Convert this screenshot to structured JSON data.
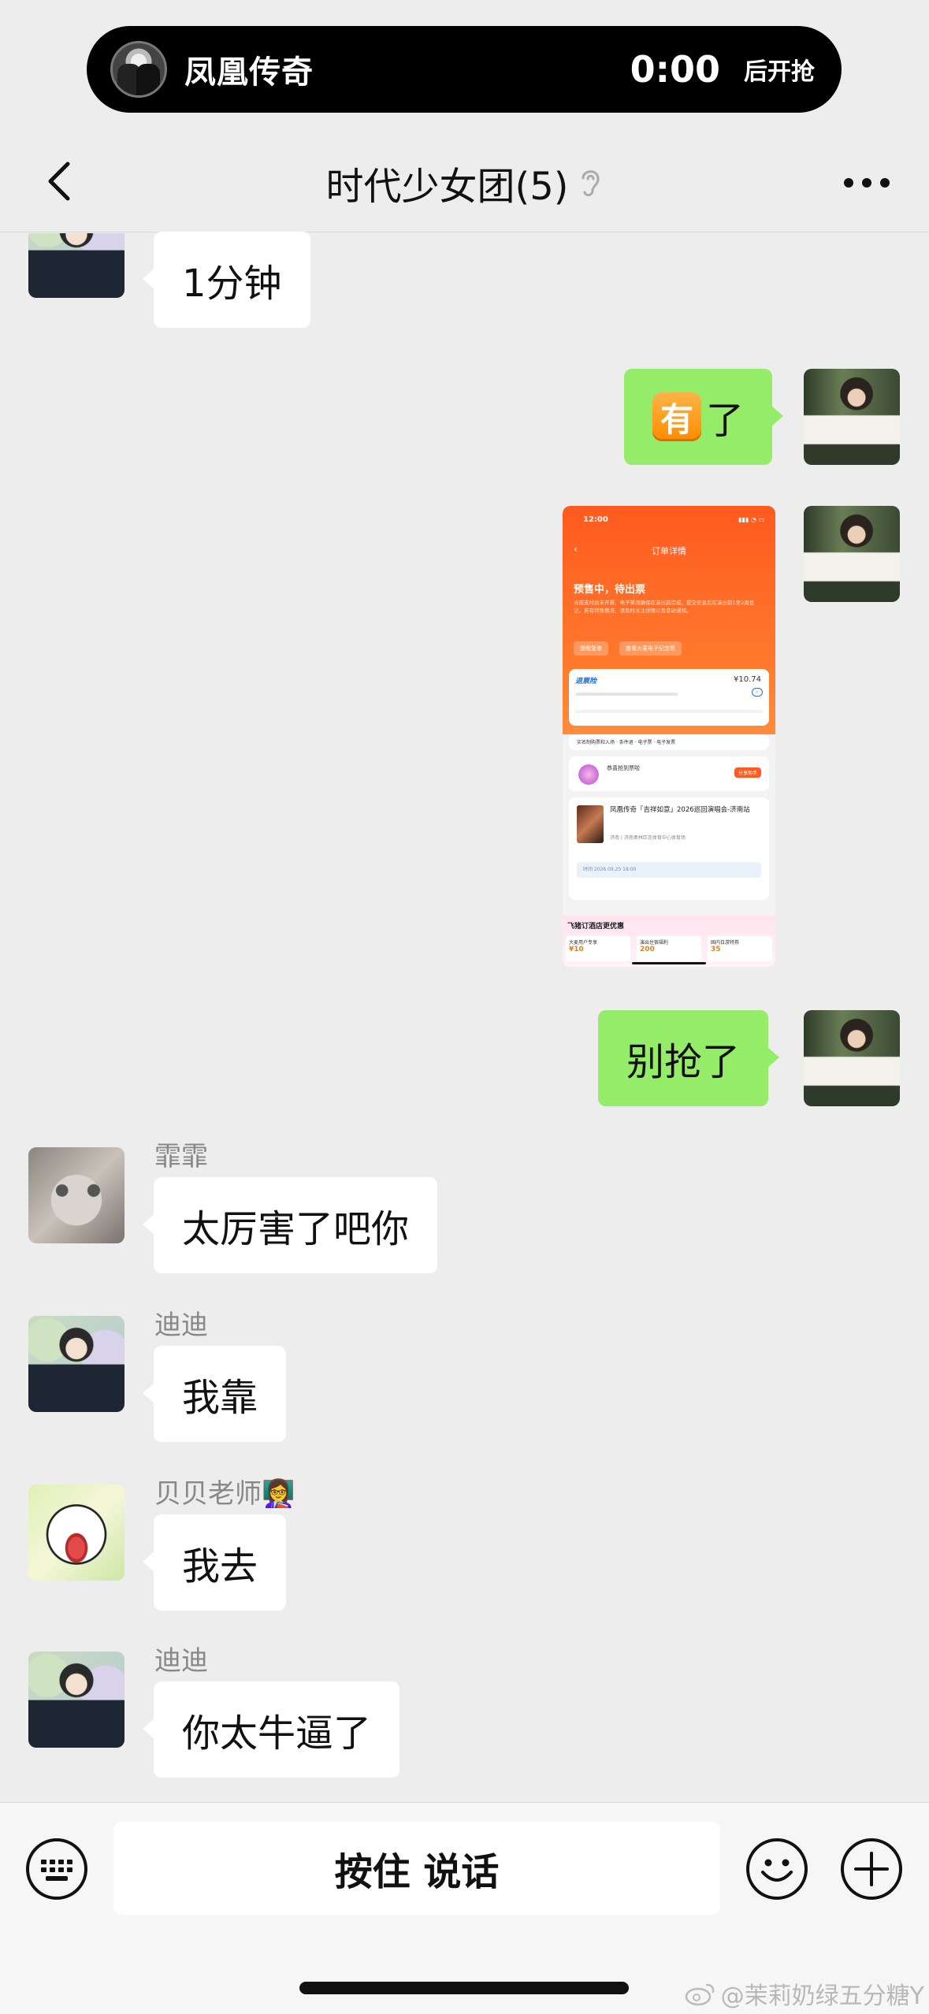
{
  "live_activity": {
    "title": "凤凰传奇",
    "countdown": "0:00",
    "suffix": "后开抢"
  },
  "header": {
    "title": "时代少女团(5)",
    "back_icon": "chevron-left-icon",
    "ear_icon": "ear-icon",
    "more_icon": "more-dots-icon"
  },
  "messages": [
    {
      "side": "in",
      "sender": "",
      "avatar": "didi-avatar",
      "text": "1分钟"
    },
    {
      "side": "out",
      "badge": "有",
      "text": "了"
    },
    {
      "side": "out",
      "type": "image",
      "image": {
        "status_time": "12:00",
        "page_title": "订单详情",
        "status": "预售中，待出票",
        "desc": "当前支付尚未开票，电子票须确保在演出前完成，提交信息后在演出前1至2周登记，若有特殊情况，请及时关注详情以及变动通知。",
        "chip_1": "提醒复查",
        "chip_2": "查看大麦电子纪念票",
        "brand": "退票险",
        "price": "¥10.74",
        "tags": "实名制购票和入场 · 条件退 · 电子票 · 电子发票",
        "lucky": "恭喜抢到票啦",
        "share": "分享助手",
        "show": "凤凰传奇「吉祥如意」2026巡回演唱会-济南站",
        "venue": "济南 | 济南奥林匹克体育中心体育场",
        "time_row": "时间 2026.09.25 18:00",
        "hotel": "飞猪订酒店更优惠",
        "deal_1": "大麦用户专享",
        "deal_1_value": "¥10",
        "deal_2": "演出住宿福利",
        "deal_2_value": "200",
        "deal_3": "国内日游特券",
        "deal_3_value": "35"
      }
    },
    {
      "side": "out",
      "text": "别抢了"
    },
    {
      "side": "in",
      "sender": "霏霏",
      "avatar": "cat-avatar",
      "text": "太厉害了吧你"
    },
    {
      "side": "in",
      "sender": "迪迪",
      "avatar": "didi-avatar",
      "text": "我靠"
    },
    {
      "side": "in",
      "sender": "贝贝老师",
      "sender_emoji": "👩‍🏫",
      "avatar": "cartoon-avatar",
      "text": "我去"
    },
    {
      "side": "in",
      "sender": "迪迪",
      "avatar": "didi-avatar",
      "text": "你太牛逼了"
    }
  ],
  "input_bar": {
    "keyboard_icon": "keyboard-icon",
    "hold_to_talk": "按住 说话",
    "emoji_icon": "smiley-icon",
    "plus_icon": "plus-circle-icon"
  },
  "watermark": "@茉莉奶绿五分糖Y",
  "colors": {
    "background": "#ededed",
    "bubble_out": "#95ec69",
    "bubble_in": "#ffffff"
  }
}
